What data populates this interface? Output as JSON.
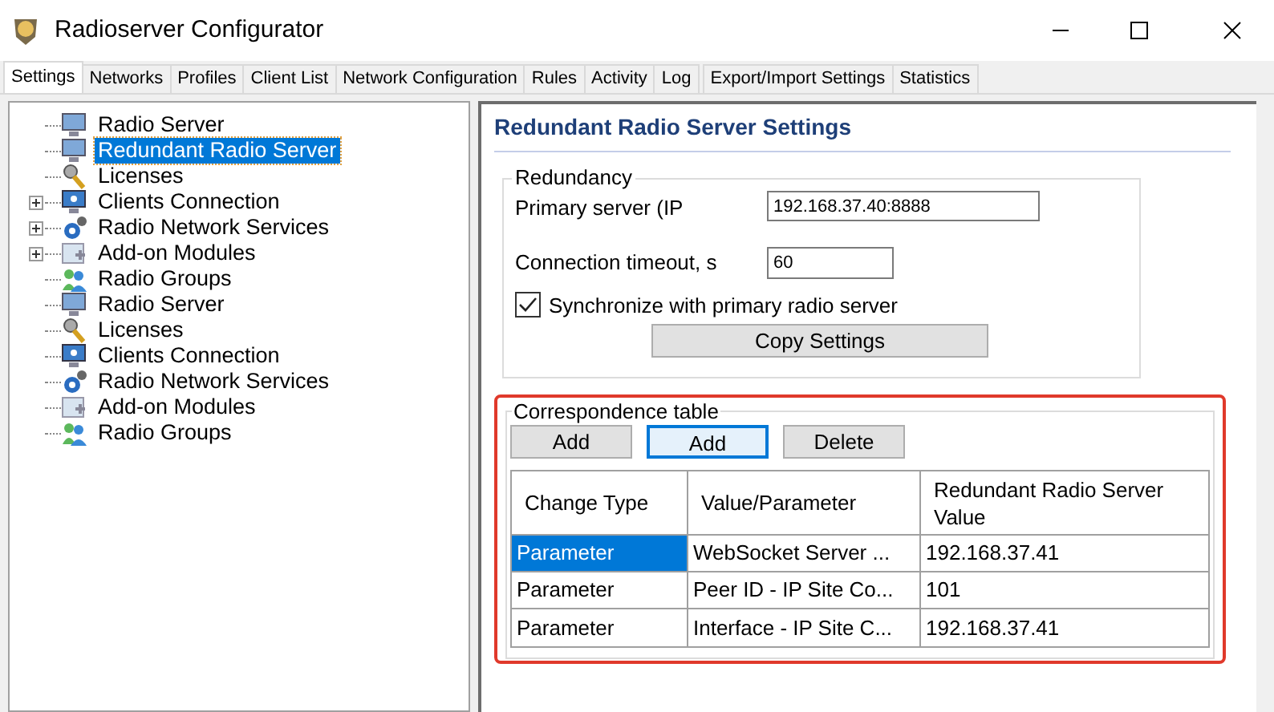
{
  "window": {
    "title": "Radioserver Configurator"
  },
  "tabs": [
    {
      "label": "Settings",
      "selected": true
    },
    {
      "label": "Networks",
      "selected": false
    },
    {
      "label": "Profiles",
      "selected": false
    },
    {
      "label": "Client List",
      "selected": false
    },
    {
      "label": "Network Configuration",
      "selected": false
    },
    {
      "label": "Rules",
      "selected": false
    },
    {
      "label": "Activity",
      "selected": false
    },
    {
      "label": "Log",
      "selected": false
    },
    {
      "label": "Export/Import Settings",
      "selected": false
    },
    {
      "label": "Statistics",
      "selected": false
    }
  ],
  "tree": [
    {
      "label": "Radio Server",
      "kind": "monitor",
      "selected": false
    },
    {
      "label": "Redundant Radio Server",
      "kind": "monitor",
      "selected": true
    },
    {
      "label": "Licenses",
      "kind": "keys",
      "selected": false
    },
    {
      "label": "Clients Connection",
      "kind": "network",
      "expanded": false,
      "selected": false
    },
    {
      "label": "Radio Network Services",
      "kind": "gear",
      "expanded": false,
      "selected": false
    },
    {
      "label": "Add-on Modules",
      "kind": "module",
      "expanded": false,
      "selected": false
    },
    {
      "label": "Radio Groups",
      "kind": "people",
      "selected": false
    },
    {
      "label": "Radio Server",
      "kind": "monitor",
      "selected": false
    },
    {
      "label": "Licenses",
      "kind": "keys",
      "selected": false
    },
    {
      "label": "Clients Connection",
      "kind": "network",
      "selected": false
    },
    {
      "label": "Radio Network Services",
      "kind": "gear",
      "selected": false
    },
    {
      "label": "Add-on Modules",
      "kind": "module",
      "selected": false
    },
    {
      "label": "Radio Groups",
      "kind": "people",
      "selected": false
    }
  ],
  "panel": {
    "heading": "Redundant Radio Server Settings",
    "redundancy": {
      "legend": "Redundancy",
      "primary_server": {
        "label": "Primary server (IP",
        "value": "192.168.37.40:8888"
      },
      "timeout": {
        "label": "Connection timeout, s",
        "value": "60"
      },
      "synchronize": {
        "label": "Synchronize with primary radio server",
        "checked": true
      },
      "copy_button": "Copy Settings"
    },
    "correspondence": {
      "legend": "Correspondence table",
      "highlighted": true,
      "buttons": [
        {
          "label": "Add",
          "focused": false
        },
        {
          "label": "Add",
          "focused": true
        },
        {
          "label": "Delete",
          "focused": false
        }
      ],
      "columns": [
        "Change Type",
        "Value/Parameter",
        "Redundant Radio Server Value"
      ],
      "rows": [
        {
          "cells": [
            "Parameter",
            "WebSocket Server ...",
            "192.168.37.41"
          ],
          "selected": true
        },
        {
          "cells": [
            "Parameter",
            "Peer ID - IP Site Co...",
            "101"
          ],
          "selected": false
        },
        {
          "cells": [
            "Parameter",
            "Interface - IP Site C...",
            "192.168.37.41"
          ],
          "selected": false
        }
      ]
    }
  }
}
